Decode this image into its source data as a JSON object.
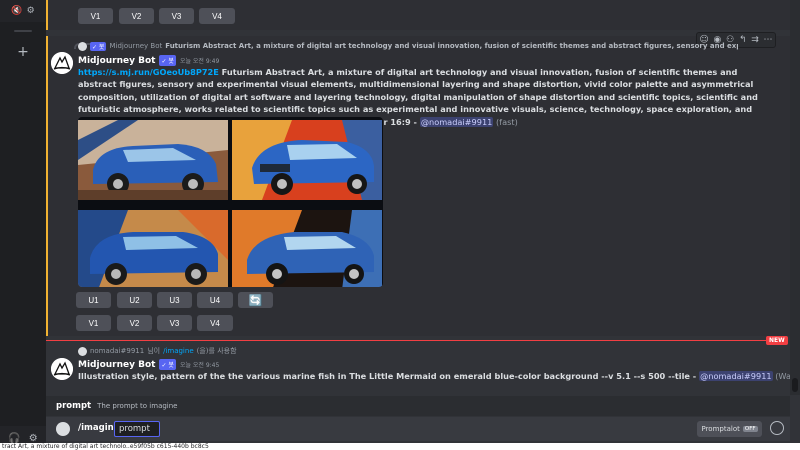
{
  "top_buttons": [
    "V1",
    "V2",
    "V3",
    "V4"
  ],
  "reply": {
    "author": "Midjourney Bot",
    "text": "Futurism Abstract Art, a mixture of digital art technology and visual innovation, fusion of scientific themes and abstract figures, sensory and experimental visu"
  },
  "message1": {
    "author": "Midjourney Bot",
    "badge": "✓ 봇",
    "timestamp": "오늘 오전 9:49",
    "link": "https://s.mj.run/GOeoUb8P72E",
    "prompt": " Futurism Abstract Art, a mixture of digital art technology and visual innovation, fusion of scientific themes and abstract figures, sensory and experimental visual elements, multidimensional layering and shape distortion, vivid color palette and asymmetrical composition, utilization of digital art software and layering technology, digital manipulation of shape distortion and scientific topics, scientific and futuristic atmosphere, works related to scientific topics such as experimental and innovative visuals, science, technology, space exploration, and Abstract art centered on morphology and color transformation --ar 16:9 - ",
    "mention": "@nomadai#9911",
    "status": " (fast)"
  },
  "upscale_buttons": [
    "U1",
    "U2",
    "U3",
    "U4"
  ],
  "variation_buttons": [
    "V1",
    "V2",
    "V3",
    "V4"
  ],
  "new_badge": "NEW",
  "message2_reply": {
    "user": "nomadai#9911",
    "middle": " 님이 ",
    "command": "/imagine",
    "suffix": "(을)를 사용함"
  },
  "message2": {
    "author": "Midjourney Bot",
    "badge": "✓ 봇",
    "timestamp": "오늘 오전 9:45",
    "prompt": "Illustration style, pattern of the the various marine fish in The Little Mermaid on emerald blue-color background --v 5.1 --s 500 --tile - ",
    "mention": "@nomadai#9911",
    "status": " (Waiting to start)"
  },
  "command_popup": {
    "name": "prompt",
    "description": "The prompt to imagine"
  },
  "input": {
    "command": "/imagine",
    "option": "prompt"
  },
  "promptalot": {
    "label": "Promptalot",
    "toggle": "OFF"
  },
  "status_bar": "tract Art, a mixture of digital art technolo..e59f05b c615-440b bc8c5",
  "colors": {
    "accent": "#5865f2",
    "link": "#00a8fc",
    "highlight_border": "#f0b232",
    "new_line": "#f23f43"
  }
}
